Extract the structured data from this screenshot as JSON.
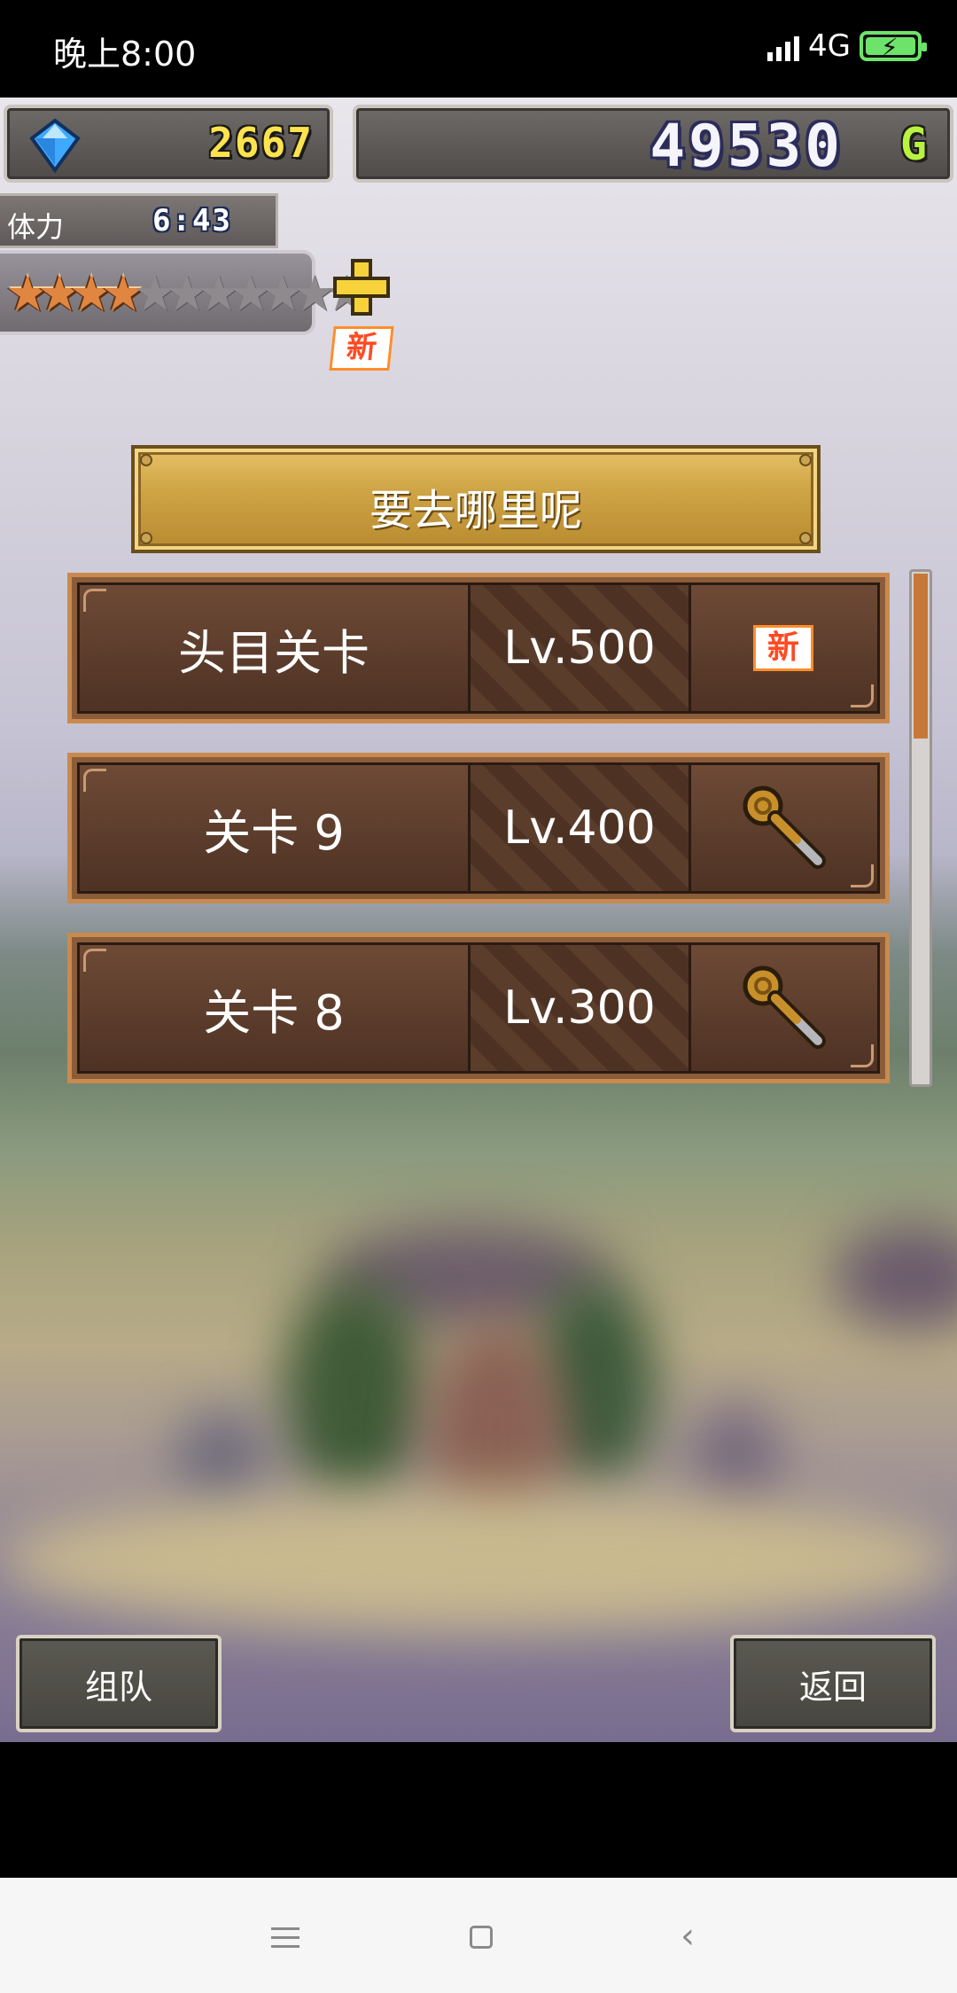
{
  "status_bar": {
    "time": "晚上8:00",
    "network": "4G"
  },
  "resources": {
    "gems": "2667",
    "gold": "49530",
    "gold_unit": "G"
  },
  "stamina": {
    "label": "体力",
    "timer": "6:43",
    "stars_filled": 4,
    "stars_total": 11
  },
  "new_badge": "新",
  "title": "要去哪里呢",
  "stages": [
    {
      "name": "头目关卡",
      "level": "Lv.500",
      "icon": "new-badge"
    },
    {
      "name": "关卡 9",
      "level": "Lv.400",
      "icon": "key-icon"
    },
    {
      "name": "关卡 8",
      "level": "Lv.300",
      "icon": "key-icon"
    }
  ],
  "buttons": {
    "team": "组队",
    "back": "返回"
  },
  "colors": {
    "gem_text": "#ffe34d",
    "gold_unit": "#b9f23f",
    "wood_border": "#c98a4e",
    "scroll_thumb": "#c67937"
  }
}
